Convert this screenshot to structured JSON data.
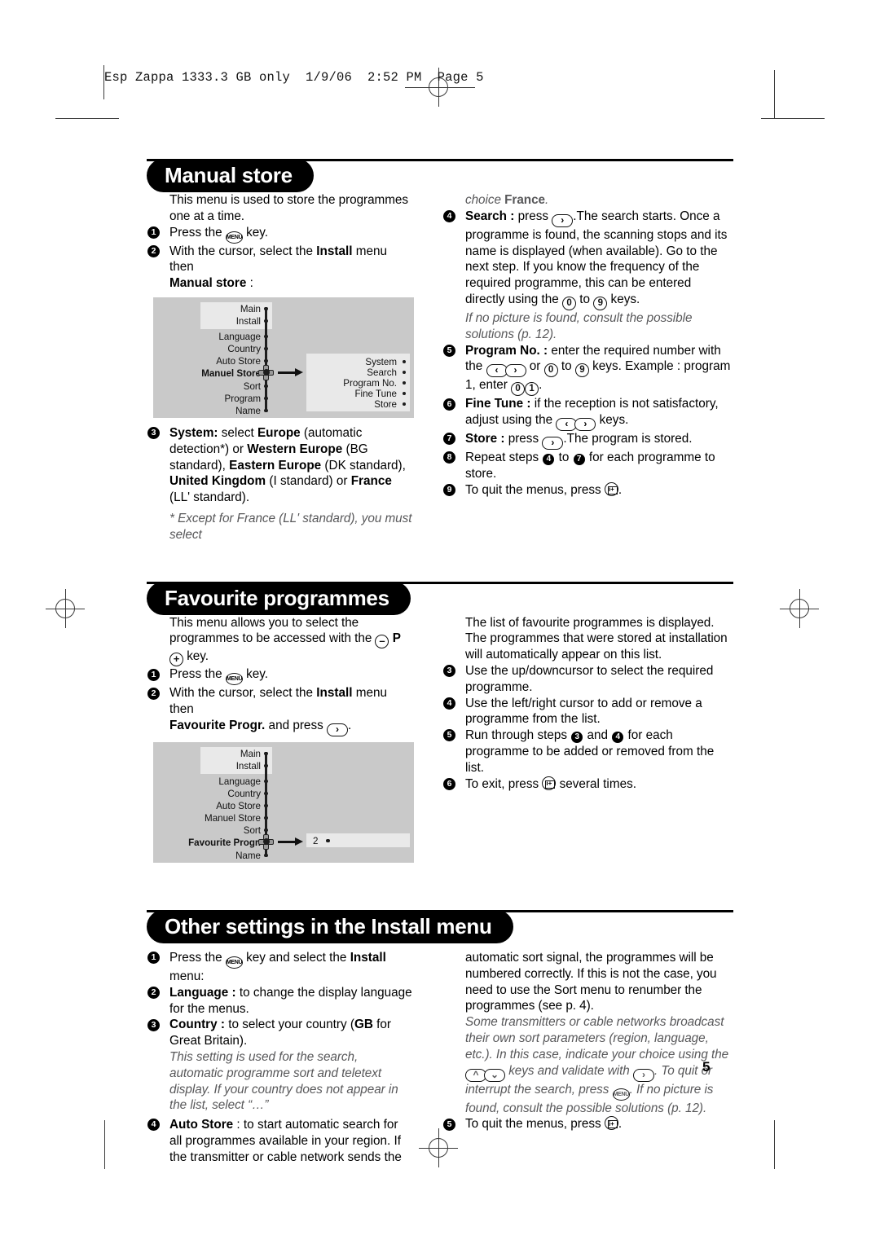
{
  "print_header": "Esp Zappa 1333.3 GB only  1/9/06  2:52 PM  Page 5",
  "page_number": "5",
  "sections": [
    {
      "id": "manual-store",
      "title": "Manual store",
      "left": {
        "intro": "This menu is used to store the programmes one at a time.",
        "steps": [
          {
            "n": "1",
            "text": "Press the MENU key."
          },
          {
            "n": "2",
            "text": "With the cursor, select the Install menu then Manual store :"
          },
          {
            "n": "3",
            "text": "System: select Europe (automatic detection*) or Western Europe (BG standard), Eastern Europe (DK standard), United Kingdom (I standard) or France (LL' standard)."
          }
        ],
        "footnote": "* Except for France (LL' standard), you must select"
      },
      "right": {
        "footnote_cont": "choice France.",
        "steps": [
          {
            "n": "4",
            "text": "Search : press >. The search starts. Once a programme is found, the scanning stops and its name is displayed (when available). Go to the next step. If you know the frequency of the required programme, this can be entered directly using the 0 to 9 keys."
          },
          {
            "n": "note",
            "text": "If no picture is found, consult the possible solutions (p. 12)."
          },
          {
            "n": "5",
            "text": "Program No. : enter the required number with the < > or 0 to 9 keys. Example : program 1, enter 0 1."
          },
          {
            "n": "6",
            "text": "Fine Tune : if the reception is not satisfactory, adjust using the < > keys."
          },
          {
            "n": "7",
            "text": "Store : press >. The program is stored."
          },
          {
            "n": "8",
            "text": "Repeat steps 4 to 7 for each programme to store."
          },
          {
            "n": "9",
            "text": "To quit the menus, press [i+]."
          }
        ]
      },
      "diagram": {
        "main_items": [
          "Main",
          "Install",
          "Language",
          "Country",
          "Auto Store",
          "Manuel Store",
          "Sort",
          "Program",
          "Name"
        ],
        "selected": "Manuel Store",
        "sub_items": [
          "System",
          "Search",
          "Program No.",
          "Fine Tune",
          "Store"
        ]
      }
    },
    {
      "id": "favourite-programmes",
      "title": "Favourite programmes",
      "left": {
        "intro": "This menu allows you to select the programmes to be accessed with the – P + key.",
        "steps": [
          {
            "n": "1",
            "text": "Press the MENU key."
          },
          {
            "n": "2",
            "text": "With the cursor, select the Install menu then Favourite Progr. and press >."
          }
        ]
      },
      "right": {
        "intro": "The list of favourite programmes is displayed. The programmes that were stored at installation will automatically appear on this list.",
        "steps": [
          {
            "n": "3",
            "text": "Use the up/downcursor to select the required programme."
          },
          {
            "n": "4",
            "text": "Use the left/right cursor to add or remove a programme from the list."
          },
          {
            "n": "5",
            "text": "Run through steps 3 and 4 for each programme to be added or removed from the list."
          },
          {
            "n": "6",
            "text": "To exit, press [i+] several times."
          }
        ]
      },
      "diagram": {
        "main_items": [
          "Main",
          "Install",
          "Language",
          "Country",
          "Auto Store",
          "Manuel Store",
          "Sort",
          "Favourite Progr.",
          "Name"
        ],
        "selected": "Favourite Progr.",
        "sub_items": [
          "2"
        ]
      }
    },
    {
      "id": "other-settings",
      "title": "Other settings in the Install menu",
      "left": {
        "steps": [
          {
            "n": "1",
            "text": "Press the MENU key and select the Install menu:"
          },
          {
            "n": "2",
            "text": "Language : to change the display language for the menus."
          },
          {
            "n": "3",
            "text": "Country : to select your country (GB for Great Britain)."
          },
          {
            "n": "note",
            "text": "This setting is used for the search, automatic programme sort and teletext display. If your country does not appear in the list, select “…”"
          },
          {
            "n": "4",
            "text": "Auto Store : to start automatic search for all programmes available in your region. If the transmitter or cable network sends the"
          }
        ]
      },
      "right": {
        "cont": "automatic sort signal, the programmes will be numbered correctly. If this is not the case, you need to use the Sort menu to renumber the programmes (see p. 4).",
        "note": "Some transmitters or cable networks broadcast their own sort parameters (region, language, etc.). In this case, indicate your choice using the ^ v keys and validate with >. To quit or interrupt the search, press MENU. If no picture is found, consult the possible solutions (p. 12).",
        "steps": [
          {
            "n": "5",
            "text": "To quit the menus, press [i+]."
          }
        ]
      }
    }
  ],
  "glyph_labels": {
    "menu": "MENU",
    "right": "›",
    "left": "‹",
    "up": "⌃",
    "down": "⌄",
    "zero": "0",
    "one": "1",
    "nine": "9",
    "minus": "–",
    "plus": "+",
    "p": "P",
    "iplus": "i+"
  }
}
